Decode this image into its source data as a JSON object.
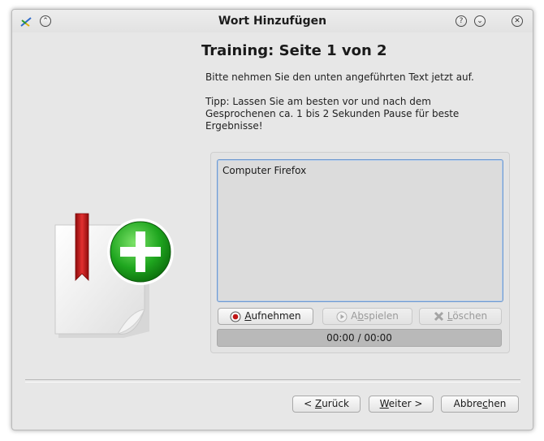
{
  "window": {
    "title": "Wort Hinzufügen",
    "help_glyph": "?",
    "minimize_glyph": "⌄",
    "close_glyph": "✕",
    "shade_glyph": "⌃"
  },
  "page": {
    "heading": "Training: Seite 1 von 2",
    "instruction": "Bitte nehmen Sie den unten angeführten Text jetzt auf.",
    "tip_line1": "Tipp: Lassen Sie am besten vor und nach dem",
    "tip_line2": "Gesprochenen ca. 1 bis 2 Sekunden Pause für beste",
    "tip_line3": "Ergebnisse!"
  },
  "recording": {
    "prompt_text": "Computer Firefox",
    "record_label_mnemonic": "A",
    "record_label_rest": "ufnehmen",
    "play_label_pre": "A",
    "play_label_mnemonic": "b",
    "play_label_rest": "spielen",
    "delete_label_mnemonic": "L",
    "delete_label_rest": "öschen",
    "time": "00:00 / 00:00"
  },
  "footer": {
    "back_pre": "< ",
    "back_mnemonic": "Z",
    "back_rest": "urück",
    "next_mnemonic": "W",
    "next_rest": "eiter >",
    "cancel_pre": "Abbre",
    "cancel_mnemonic": "c",
    "cancel_rest": "hen"
  },
  "icons": [
    "add-word-icon",
    "record-icon",
    "play-icon",
    "delete-icon",
    "app-icon"
  ],
  "colors": {
    "accent": "#6f9ad0",
    "record": "#c01515",
    "plus_green": "#22a622"
  }
}
